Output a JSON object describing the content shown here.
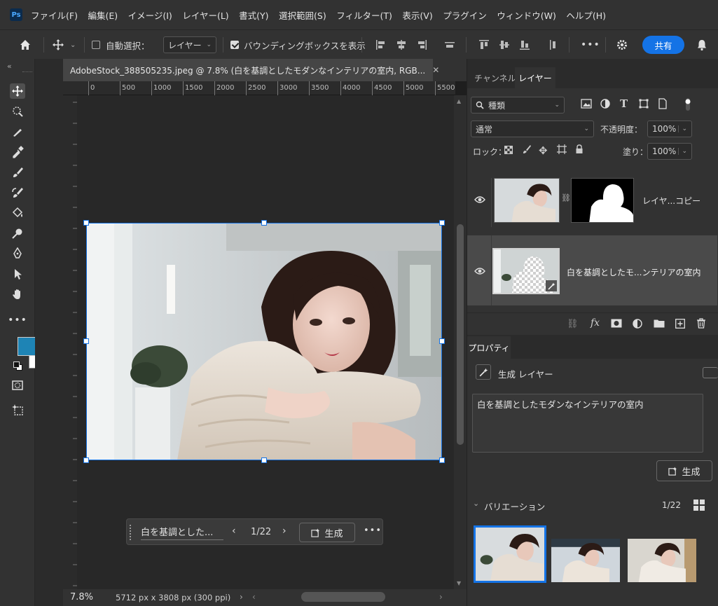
{
  "app": {
    "logo": "Ps"
  },
  "menu": [
    "ファイル(F)",
    "編集(E)",
    "イメージ(I)",
    "レイヤー(L)",
    "書式(Y)",
    "選択範囲(S)",
    "フィルター(T)",
    "表示(V)",
    "プラグイン",
    "ウィンドウ(W)",
    "ヘルプ(H)"
  ],
  "options": {
    "auto_select_label": "自動選択：",
    "auto_select_checked": false,
    "target_value": "レイヤー",
    "bbox_label": "バウンディングボックスを表示",
    "bbox_checked": true,
    "more": "•••",
    "share_label": "共有"
  },
  "document": {
    "tab_title": "AdobeStock_388505235.jpeg @ 7.8% (白を基調としたモダンなインテリアの室内, RGB...",
    "ruler_ticks": [
      "0",
      "500",
      "1000",
      "1500",
      "2000",
      "2500",
      "3000",
      "3500",
      "4000",
      "4500",
      "5000",
      "5500"
    ],
    "zoom": "7.8%",
    "doc_info": "5712 px x 3808 px (300 ppi)"
  },
  "context_bar": {
    "prompt": "白を基調とした...",
    "counter": "1/22",
    "generate_label": "生成",
    "more": "•••"
  },
  "panels": {
    "tabs": [
      "チャンネル",
      "レイヤー"
    ],
    "active_tab": "レイヤー",
    "filter_kind": "種類",
    "blend_mode": "通常",
    "opacity_label": "不透明度：",
    "opacity_value": "100%",
    "lock_label": "ロック：",
    "fill_label": "塗り：",
    "fill_value": "100%",
    "layers": [
      {
        "name": "レイヤ...コピー",
        "visible": true,
        "selected": false
      },
      {
        "name": "白を基調としたモ...ンテリアの室内",
        "visible": true,
        "selected": true
      }
    ]
  },
  "properties": {
    "tab": "プロパティ",
    "layer_type": "生成 レイヤー",
    "prompt_text": "白を基調としたモダンなインテリアの室内",
    "generate_label": "生成",
    "variations_label": "バリエーション",
    "variations_count": "1/22"
  },
  "colors": {
    "foreground": "#1e84b5",
    "background": "#ffffff",
    "accent": "#1473e6"
  }
}
